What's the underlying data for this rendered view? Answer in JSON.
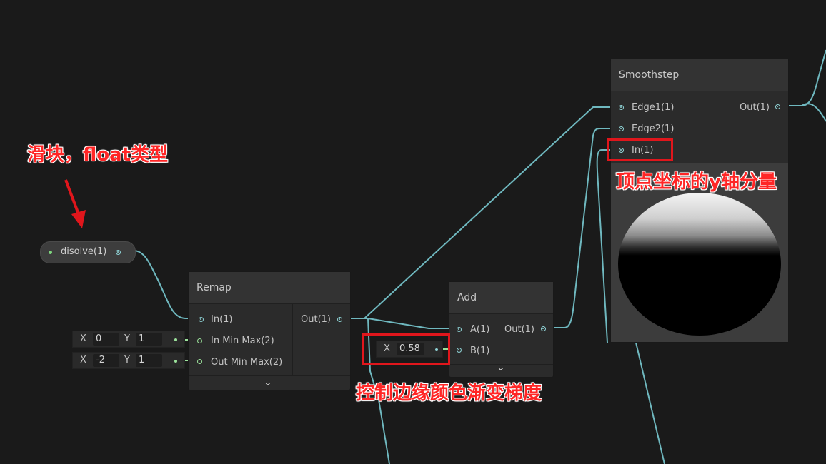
{
  "accent_wire": "#6fb8bf",
  "property_node": {
    "label": "disolve(1)"
  },
  "remap": {
    "title": "Remap",
    "in": "In(1)",
    "in_min_max": "In Min Max(2)",
    "out_min_max": "Out Min Max(2)",
    "out": "Out(1)",
    "in_min_max_x_label": "X",
    "in_min_max_x": "0",
    "in_min_max_y_label": "Y",
    "in_min_max_y": "1",
    "out_min_max_x_label": "X",
    "out_min_max_x": "-2",
    "out_min_max_y_label": "Y",
    "out_min_max_y": "1"
  },
  "add": {
    "title": "Add",
    "a": "A(1)",
    "b": "B(1)",
    "out": "Out(1)",
    "b_x_label": "X",
    "b_x_value": "0.58"
  },
  "smoothstep": {
    "title": "Smoothstep",
    "edge1": "Edge1(1)",
    "edge2": "Edge2(1)",
    "in": "In(1)",
    "out": "Out(1)"
  },
  "annotations": {
    "slider": "滑块，float类型",
    "vertex": "顶点坐标的y轴分量",
    "gradient": "控制边缘颜色渐变梯度"
  }
}
